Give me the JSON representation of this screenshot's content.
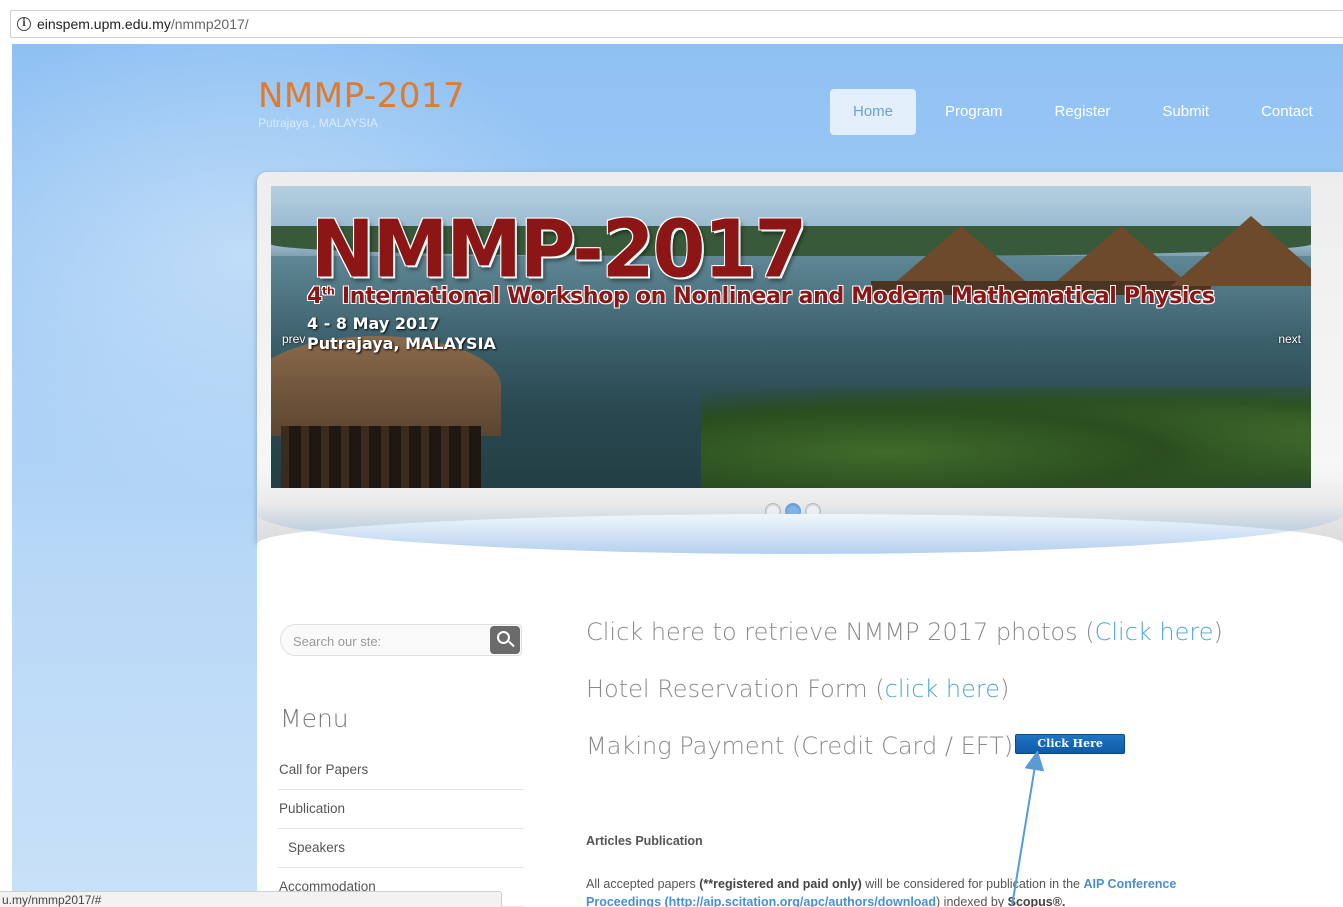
{
  "browser": {
    "url_host": "einspem.upm.edu.my",
    "url_path": "/nmmp2017/",
    "status_url": "u.my/nmmp2017/#"
  },
  "site": {
    "title": "NMMP-2017",
    "subtitle": "Putrajaya , MALAYSIA",
    "title_color": "#e07a2c"
  },
  "nav": {
    "items": [
      "Home",
      "Program",
      "Register",
      "Submit",
      "Contact"
    ],
    "active": "Home"
  },
  "slider": {
    "banner_title": "NMMP-2017",
    "banner_workshop_ordinal": "4",
    "banner_workshop_sup": "th",
    "banner_workshop_rest": " International Workshop on Nonlinear and Modern Mathematical Physics",
    "banner_date": "4 - 8 May 2017",
    "banner_location": "Putrajaya, MALAYSIA",
    "prev_label": "prev",
    "next_label": "next",
    "dot_count": 3,
    "active_dot": 2
  },
  "sidebar": {
    "search_placeholder": "Search our ste:",
    "menu_title": "Menu",
    "menu_items": [
      "Call for Papers",
      "Publication",
      "Speakers",
      "Accommodation"
    ]
  },
  "main": {
    "photos_text": "Click here to retrieve NMMP 2017 photos (",
    "photos_link": "Click here",
    "photos_close": ")",
    "hotel_text": "Hotel Reservation Form (",
    "hotel_link": "click here",
    "hotel_close": ")",
    "payment_text": "Making Payment (Credit Card / EFT)",
    "payment_button": "Click Here",
    "articles_heading": "Articles Publication",
    "articles_p1": "All accepted  papers ",
    "articles_p1_bold": "(**registered and paid only)",
    "articles_p1_rest": " will be considered for publication in the ",
    "articles_aip": "AIP Conference",
    "articles_p2_link": "Proceedings (http://aip.scitation.org/apc/authors/download",
    "articles_p2_rest": ") indexed by  ",
    "articles_p2_bold": "Scopus®."
  },
  "colors": {
    "link": "#4ba6d9",
    "button": "#1566b5",
    "annotation_arrow": "#5b9bd5"
  }
}
